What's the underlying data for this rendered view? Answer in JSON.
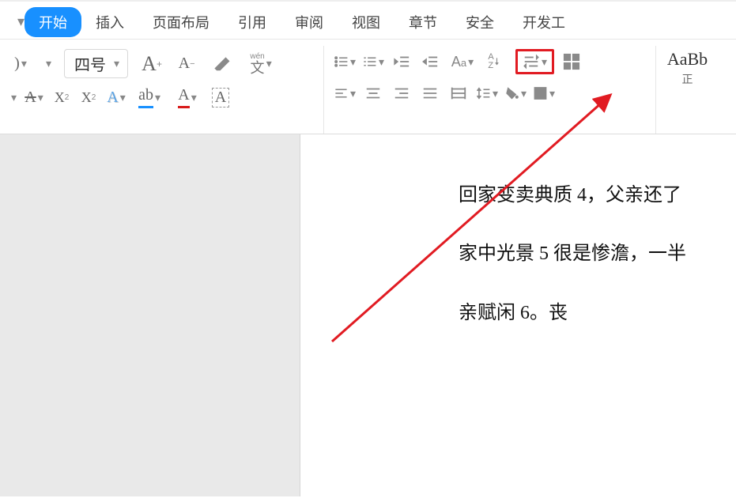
{
  "tabs": {
    "start": "开始",
    "insert": "插入",
    "page_layout": "页面布局",
    "reference": "引用",
    "review": "审阅",
    "view": "视图",
    "chapter": "章节",
    "security": "安全",
    "dev_tools": "开发工"
  },
  "font": {
    "size_value": "四号",
    "inc_label": "A",
    "dec_label": "A",
    "upper_A": "A",
    "lower_a": "a",
    "abc_highlight": "ab",
    "font_color_letter": "A",
    "char_border": "A",
    "super_label": "X²",
    "sub_label": "X₂",
    "style_A": "A",
    "text_effect": "A",
    "clear_btn": ")"
  },
  "paragraph": {
    "az_letter_top": "A",
    "az_letter_bottom": "Z"
  },
  "styles": {
    "sample": "AaBb",
    "label": "正"
  },
  "document": {
    "para1": "回家变卖典质 4，父亲还了",
    "para2": "家中光景 5 很是惨澹，一半",
    "para3": "亲赋闲 6。丧"
  },
  "icons": {
    "dropdown": "▾"
  }
}
